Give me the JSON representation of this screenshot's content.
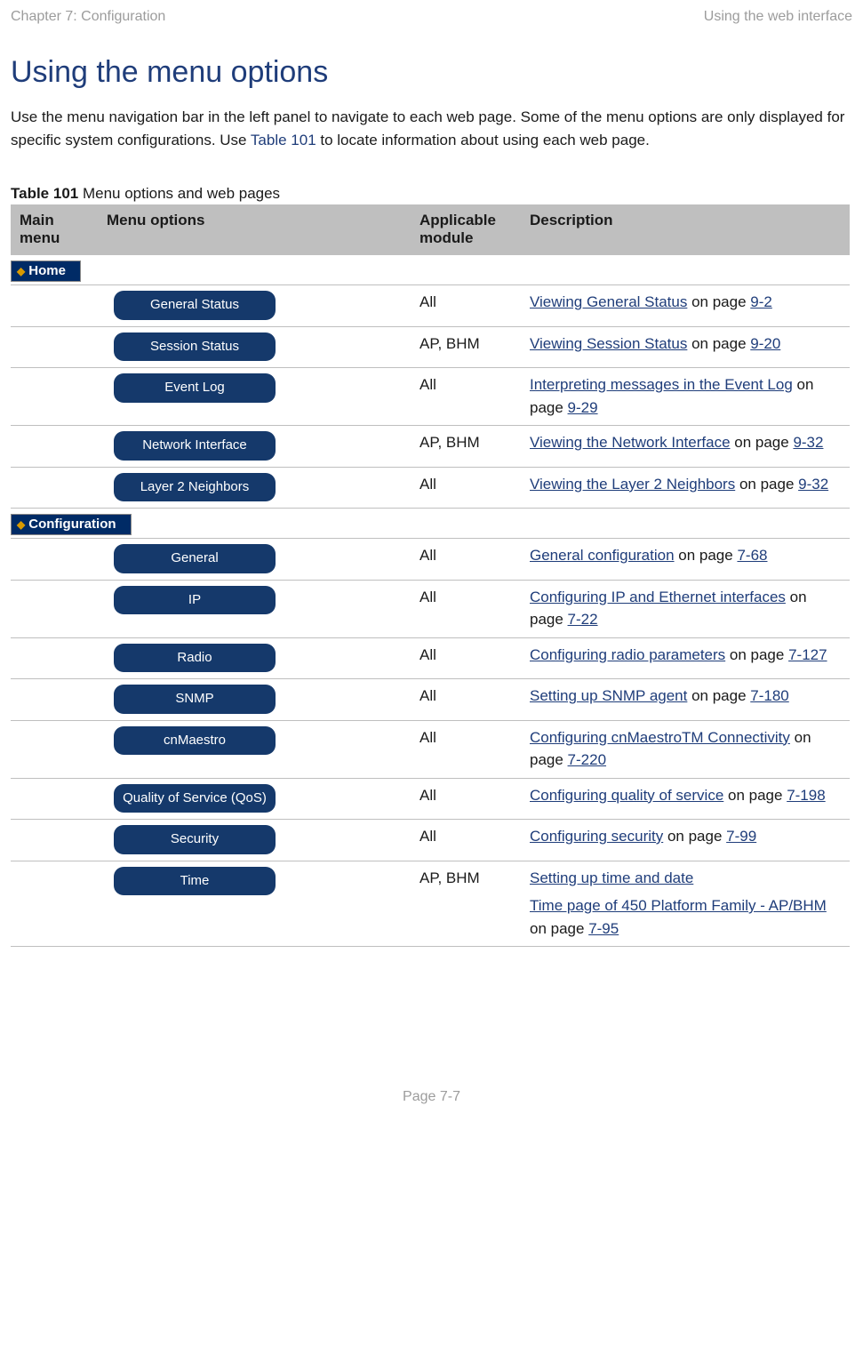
{
  "header": {
    "left": "Chapter 7:  Configuration",
    "right": "Using the web interface"
  },
  "title": "Using the menu options",
  "intro_pre": "Use the menu navigation bar in the left panel to navigate to each web page. Some of the menu options are only displayed for specific system configurations. Use ",
  "intro_link": "Table 101",
  "intro_post": " to locate information about using each web page.",
  "table_caption_bold": "Table 101",
  "table_caption_rest": " Menu options and web pages",
  "columns": {
    "c1": "Main menu",
    "c2": "Menu options",
    "c3": "Applicable module",
    "c4": "Description"
  },
  "sections": [
    {
      "chip": "Home",
      "rows": [
        {
          "option": "General Status",
          "module": "All",
          "desc_link": "Viewing General Status",
          "desc_post": " on page ",
          "page": "9-2"
        },
        {
          "option": "Session Status",
          "module": "AP, BHM",
          "desc_link": "Viewing Session Status",
          "desc_post": " on page ",
          "page": "9-20"
        },
        {
          "option": "Event Log",
          "module": "All",
          "desc_link": "Interpreting messages in the Event Log",
          "desc_post": " on page ",
          "page": "9-29"
        },
        {
          "option": "Network Interface",
          "module": "AP, BHM",
          "desc_link": "Viewing the Network Interface",
          "desc_post": " on page ",
          "page": "9-32"
        },
        {
          "option": "Layer 2 Neighbors",
          "module": "All",
          "desc_link": "Viewing the Layer 2 Neighbors",
          "desc_post": " on page ",
          "page": "9-32"
        }
      ]
    },
    {
      "chip": "Configuration",
      "rows": [
        {
          "option": "General",
          "module": "All",
          "desc_link": "General configuration",
          "desc_post": " on page ",
          "page": "7-68"
        },
        {
          "option": "IP",
          "module": "All",
          "desc_link": "Configuring IP and Ethernet interfaces",
          "desc_post": " on page ",
          "page": "7-22"
        },
        {
          "option": "Radio",
          "module": "All",
          "desc_link": "Configuring radio parameters",
          "desc_post": " on page ",
          "page": "7-127"
        },
        {
          "option": "SNMP",
          "module": "All",
          "desc_link": "Setting up SNMP agent",
          "desc_post": " on page ",
          "page": "7-180"
        },
        {
          "option": "cnMaestro",
          "module": "All",
          "desc_link": "Configuring cnMaestroTM Connectivity",
          "desc_post": " on page ",
          "page": "7-220"
        },
        {
          "option": "Quality of Service (QoS)",
          "module": "All",
          "desc_link": "Configuring quality of service",
          "desc_post": " on page ",
          "page": "7-198"
        },
        {
          "option": "Security",
          "module": "All",
          "desc_link": "Configuring security",
          "desc_post": " on page ",
          "page": "7-99"
        },
        {
          "option": "Time",
          "module": "AP, BHM",
          "desc_link": "Setting up time and date",
          "desc_post": "",
          "extra_link": "Time page of 450 Platform Family - AP/BHM",
          "extra_post": " on page ",
          "extra_page": "7-95"
        }
      ]
    }
  ],
  "footer": "Page 7-7"
}
